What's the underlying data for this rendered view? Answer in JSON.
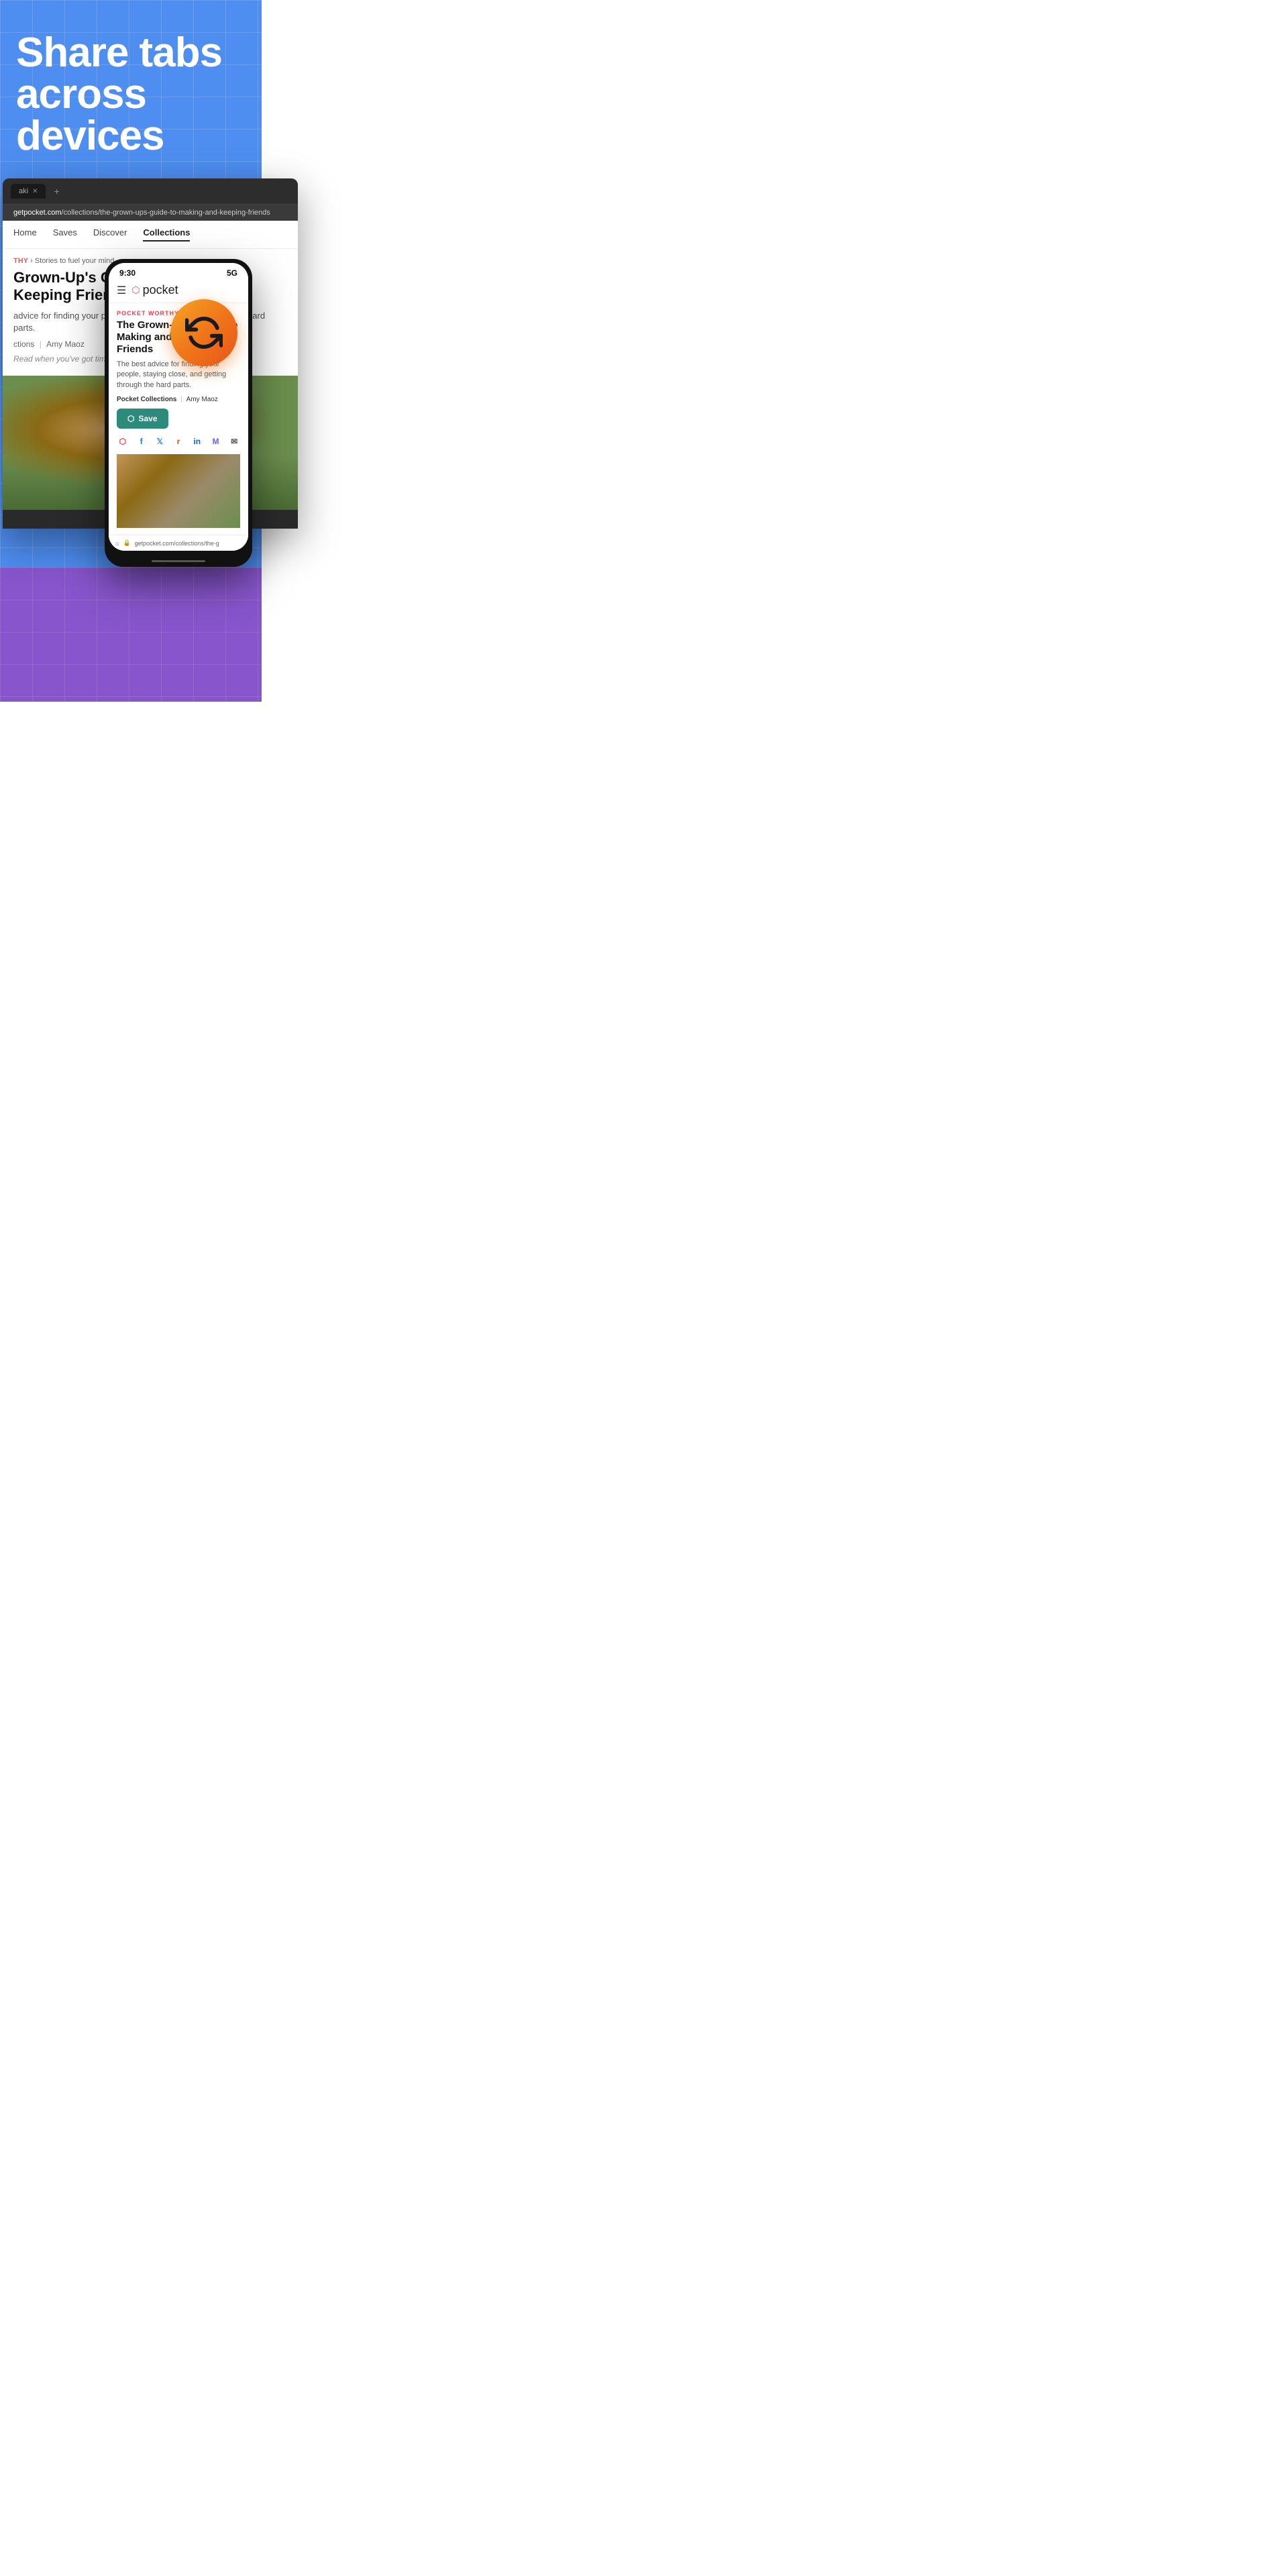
{
  "hero": {
    "title_line1": "Share tabs",
    "title_line2": "across devices",
    "background_color": "#4d8ef0"
  },
  "laptop": {
    "tab_label": "aki",
    "address_bar_prefix": "getpocket.com",
    "address_bar_path": "/collections/the-grown-ups-guide-to-making-and-keeping-friends",
    "nav_items": [
      "Home",
      "Saves",
      "Discover",
      "Collections"
    ],
    "active_nav": "Collections",
    "breadcrumb_brand": "THY",
    "breadcrumb_separator": "›",
    "breadcrumb_section": "Stories to fuel your mind",
    "article_title": "Grown-Up's Guide to Making and Keeping Friends",
    "article_desc": "advice for finding your people, staying close, and getting the hard parts.",
    "article_byline_left": "ctions",
    "article_byline_sep": "|",
    "article_byline_right": "Amy Maoz",
    "article_read_note": "Read when you've got time to spare."
  },
  "phone": {
    "status_time": "9:30",
    "status_signal": "5G",
    "menu_icon": "☰",
    "pocket_logo": "pocket",
    "pocket_worthy_tag": "POCKET WORTHY",
    "article_title": "The Grown-Up's Guide to Making and Keeping Friends",
    "article_desc": "The best advice for finding your people, staying close, and getting through the hard parts.",
    "byline_left": "Pocket Collections",
    "byline_sep": "|",
    "byline_right": "Amy Maoz",
    "save_button": "Save",
    "address_bar_text": "getpocket.com/collections/the-g"
  },
  "sync_icon": {
    "label": "sync"
  },
  "bottom": {
    "background_color": "#8855cc"
  }
}
